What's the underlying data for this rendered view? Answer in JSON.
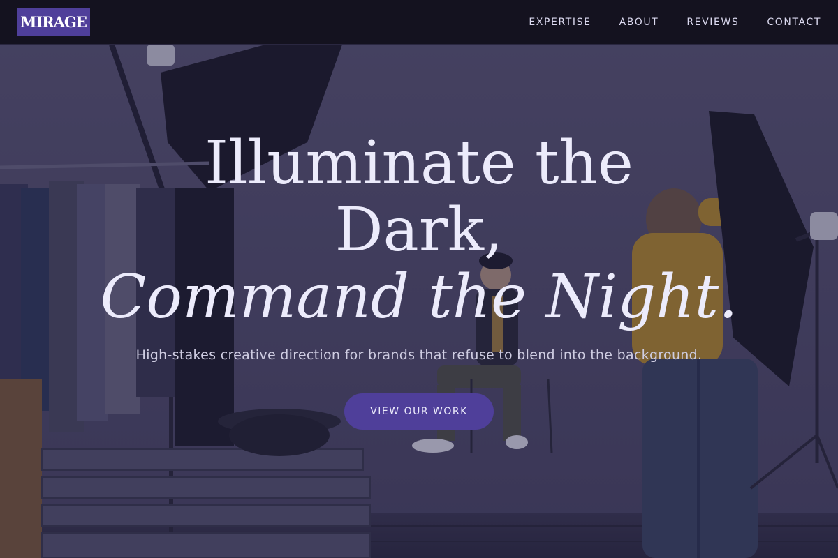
{
  "brand": {
    "logo_text": "MIRAGE",
    "accent": "#4f3f9a"
  },
  "nav": {
    "items": [
      {
        "label": "EXPERTISE"
      },
      {
        "label": "ABOUT"
      },
      {
        "label": "REVIEWS"
      },
      {
        "label": "CONTACT"
      }
    ]
  },
  "hero": {
    "headline_line1": "Illuminate the",
    "headline_line2": "Dark,",
    "headline_line3": "Command the Night.",
    "subtitle": "High-stakes creative direction for brands that refuse to blend into the background.",
    "cta_label": "VIEW OUR WORK",
    "background": "photo-studio-shoot-image"
  },
  "colors": {
    "nav_bg": "#14121f",
    "headline": "#ecebfb",
    "button": "#4f3f9a"
  }
}
